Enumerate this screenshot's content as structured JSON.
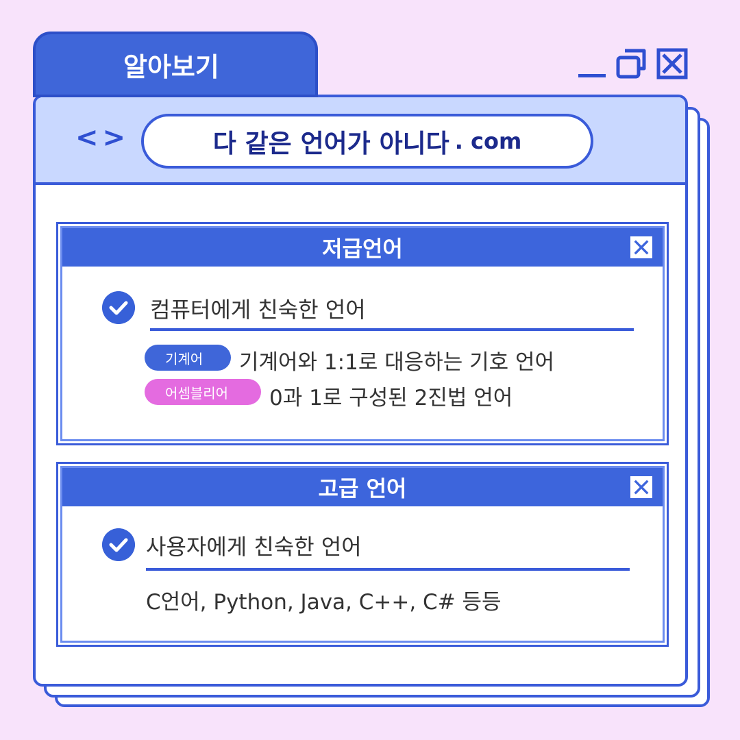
{
  "tab": {
    "title": "알아보기"
  },
  "window_controls": [
    "minimize-icon",
    "restore-icon",
    "close-icon"
  ],
  "address_bar": {
    "nav": "<>",
    "url_main": "다 같은 언어가 아니다",
    "url_domain": ". com"
  },
  "panels": [
    {
      "title": "저급언어",
      "item_title": "컴퓨터에게 친숙한 언어",
      "rows": [
        {
          "tag": "기계어",
          "tag_color": "#3f66d9",
          "text": "기계어와 1:1로 대응하는 기호 언어"
        },
        {
          "tag": "어셈블리어",
          "tag_color": "#e46be0",
          "text": "0과 1로 구성된 2진법 언어"
        }
      ]
    },
    {
      "title": "고급 언어",
      "item_title": "사용자에게 친숙한 언어",
      "text": "C언어, Python, Java, C++, C# 등등"
    }
  ],
  "colors": {
    "background": "#f8e3fb",
    "accent": "#3a5bd9",
    "address_bar": "#c9d8ff",
    "tag_blue": "#3f66d9",
    "tag_pink": "#e46be0"
  }
}
